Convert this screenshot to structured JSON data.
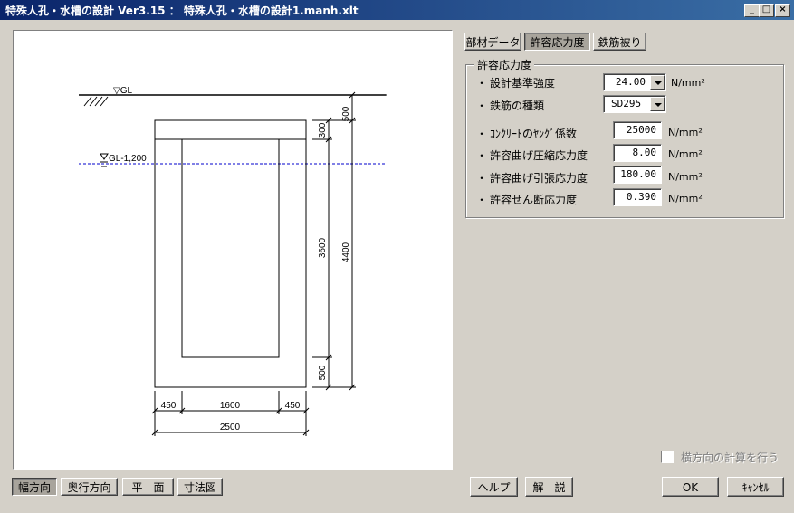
{
  "window": {
    "title": "特殊人孔・水槽の設計  Ver3.15  ：  特殊人孔・水槽の設計1.manh.xlt"
  },
  "tabs": [
    {
      "label": "部材データ"
    },
    {
      "label": "許容応力度"
    },
    {
      "label": "鉄筋被り"
    }
  ],
  "group": {
    "title": "許容応力度"
  },
  "rows": [
    {
      "bullet": "・",
      "label": "設計基準強度",
      "value": "24.00",
      "unit": "N/mm²"
    },
    {
      "bullet": "・",
      "label": "鉄筋の種類",
      "value": "SD295",
      "unit": ""
    },
    {
      "bullet": "・",
      "label": "ｺﾝｸﾘｰﾄのﾔﾝｸﾞ係数",
      "value": "25000",
      "unit": "N/mm²"
    },
    {
      "bullet": "・",
      "label": "許容曲げ圧縮応力度",
      "value": "8.00",
      "unit": "N/mm²"
    },
    {
      "bullet": "・",
      "label": "許容曲げ引張応力度",
      "value": "180.00",
      "unit": "N/mm²"
    },
    {
      "bullet": "・",
      "label": "許容せん断応力度",
      "value": "0.390",
      "unit": "N/mm²"
    }
  ],
  "checkbox": {
    "label": "横方向の計算を行う",
    "checked": false
  },
  "view_buttons": [
    "幅方向",
    "奥行方向",
    "平　面",
    "寸法図"
  ],
  "buttons": {
    "help": "ヘルプ",
    "explain": "解　説",
    "ok": "OK",
    "cancel": "ｷｬﾝｾﾙ"
  },
  "drawing": {
    "gl_label": "▽GL",
    "water_label": "GL-1,200",
    "dims_right": [
      "500",
      "300",
      "3600",
      "500",
      "4400"
    ],
    "dims_bottom": [
      "450",
      "1600",
      "450",
      "2500"
    ]
  }
}
